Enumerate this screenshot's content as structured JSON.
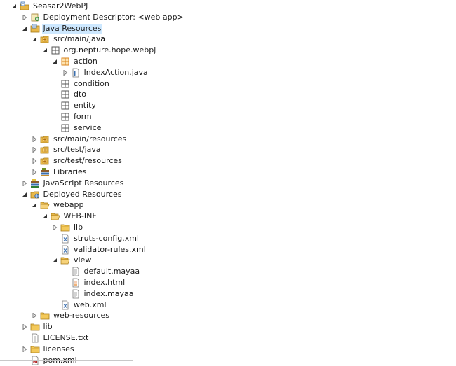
{
  "tree": [
    {
      "label": "Seasar2WebPJ",
      "depth": 0,
      "twisty": "open",
      "icon": "project-icon"
    },
    {
      "label": "Deployment Descriptor: <web app>",
      "depth": 1,
      "twisty": "closed",
      "icon": "descriptor-icon"
    },
    {
      "label": "Java Resources",
      "depth": 1,
      "twisty": "open",
      "icon": "java-resources-icon",
      "selected": true
    },
    {
      "label": "src/main/java",
      "depth": 2,
      "twisty": "open",
      "icon": "source-folder-icon"
    },
    {
      "label": "org.nepture.hope.webpj",
      "depth": 3,
      "twisty": "open",
      "icon": "package-icon"
    },
    {
      "label": "action",
      "depth": 4,
      "twisty": "open",
      "icon": "package-orange-icon"
    },
    {
      "label": "IndexAction.java",
      "depth": 5,
      "twisty": "closed",
      "icon": "java-file-icon"
    },
    {
      "label": "condition",
      "depth": 4,
      "twisty": "none",
      "icon": "package-icon"
    },
    {
      "label": "dto",
      "depth": 4,
      "twisty": "none",
      "icon": "package-icon"
    },
    {
      "label": "entity",
      "depth": 4,
      "twisty": "none",
      "icon": "package-icon"
    },
    {
      "label": "form",
      "depth": 4,
      "twisty": "none",
      "icon": "package-icon"
    },
    {
      "label": "service",
      "depth": 4,
      "twisty": "none",
      "icon": "package-icon"
    },
    {
      "label": "src/main/resources",
      "depth": 2,
      "twisty": "closed",
      "icon": "source-folder-icon"
    },
    {
      "label": "src/test/java",
      "depth": 2,
      "twisty": "closed",
      "icon": "source-folder-icon"
    },
    {
      "label": "src/test/resources",
      "depth": 2,
      "twisty": "closed",
      "icon": "source-folder-icon"
    },
    {
      "label": "Libraries",
      "depth": 2,
      "twisty": "closed",
      "icon": "libraries-icon"
    },
    {
      "label": "JavaScript Resources",
      "depth": 1,
      "twisty": "closed",
      "icon": "javascript-resources-icon"
    },
    {
      "label": "Deployed Resources",
      "depth": 1,
      "twisty": "open",
      "icon": "deployed-resources-icon"
    },
    {
      "label": "webapp",
      "depth": 2,
      "twisty": "open",
      "icon": "folder-open-icon"
    },
    {
      "label": "WEB-INF",
      "depth": 3,
      "twisty": "open",
      "icon": "folder-open-icon"
    },
    {
      "label": "lib",
      "depth": 4,
      "twisty": "closed",
      "icon": "folder-icon"
    },
    {
      "label": "struts-config.xml",
      "depth": 4,
      "twisty": "none",
      "icon": "xml-file-icon"
    },
    {
      "label": "validator-rules.xml",
      "depth": 4,
      "twisty": "none",
      "icon": "xml-file-icon"
    },
    {
      "label": "view",
      "depth": 4,
      "twisty": "open",
      "icon": "folder-open-icon"
    },
    {
      "label": "default.mayaa",
      "depth": 5,
      "twisty": "none",
      "icon": "text-file-icon"
    },
    {
      "label": "index.html",
      "depth": 5,
      "twisty": "none",
      "icon": "html-file-icon"
    },
    {
      "label": "index.mayaa",
      "depth": 5,
      "twisty": "none",
      "icon": "text-file-icon"
    },
    {
      "label": "web.xml",
      "depth": 4,
      "twisty": "none",
      "icon": "xml-file-icon"
    },
    {
      "label": "web-resources",
      "depth": 2,
      "twisty": "closed",
      "icon": "folder-icon"
    },
    {
      "label": "lib",
      "depth": 1,
      "twisty": "closed",
      "icon": "folder-icon"
    },
    {
      "label": "LICENSE.txt",
      "depth": 1,
      "twisty": "none",
      "icon": "text-file-icon"
    },
    {
      "label": "licenses",
      "depth": 1,
      "twisty": "closed",
      "icon": "folder-icon"
    },
    {
      "label": "pom.xml",
      "depth": 1,
      "twisty": "none",
      "icon": "maven-pom-icon"
    }
  ],
  "colors": {
    "selection": "#cde8ff",
    "folder": "#e8b84a",
    "package_orange": "#d9831c",
    "java_blue": "#3a6fb0"
  }
}
